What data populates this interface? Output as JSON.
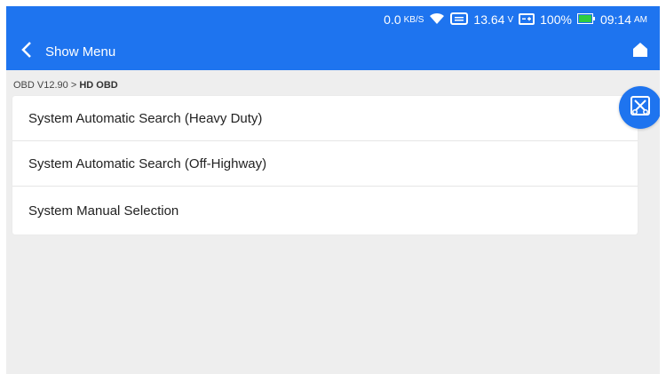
{
  "status_bar": {
    "net_speed": "0.0",
    "net_unit": "KB/S",
    "voltage": "13.64",
    "voltage_unit": "V",
    "battery": "100%",
    "time": "09:14",
    "am_pm": "AM",
    "icons": [
      "wifi-icon",
      "obd-connector-icon",
      "vehicle-battery-icon",
      "battery-icon"
    ]
  },
  "toolbar": {
    "back_icon": "chevron-left-icon",
    "title": "Show Menu",
    "home_icon": "home-icon"
  },
  "breadcrumb": {
    "path": "OBD V12.90",
    "separator": ">",
    "current": "HD OBD"
  },
  "menu": {
    "items": [
      {
        "label": "System Automatic Search (Heavy Duty)"
      },
      {
        "label": "System Automatic Search (Off-Highway)"
      },
      {
        "label": "System Manual Selection"
      }
    ]
  },
  "fab": {
    "icon": "scissors-tool-icon"
  },
  "colors": {
    "accent": "#1e74ef",
    "background": "#eeeeee",
    "card": "#ffffff"
  }
}
